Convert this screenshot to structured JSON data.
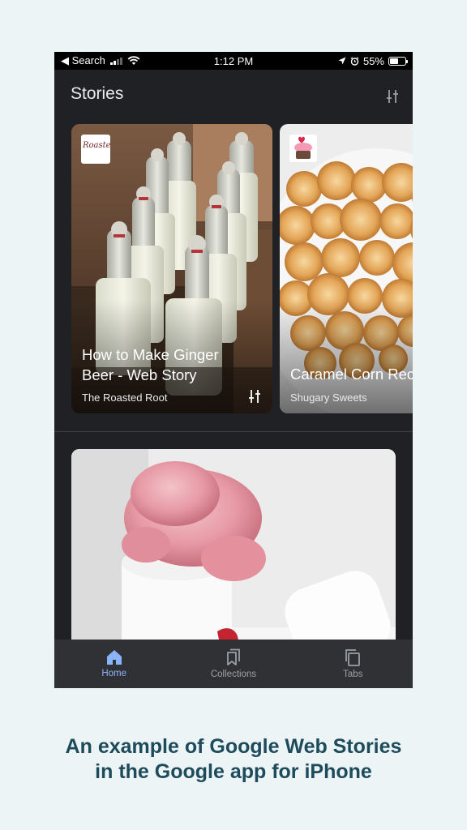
{
  "status_bar": {
    "back_label": "◀ Search",
    "time": "1:12 PM",
    "battery": "55%",
    "battery_level": 0.55
  },
  "header": {
    "title": "Stories"
  },
  "stories": [
    {
      "title": "How to Make Ginger Beer - Web Story",
      "source": "The Roasted Root"
    },
    {
      "title": "Caramel Corn Rec",
      "source": "Shugary Sweets"
    }
  ],
  "bottom_nav": {
    "items": [
      {
        "label": "Home",
        "icon": "home-icon",
        "active": true
      },
      {
        "label": "Collections",
        "icon": "collections-icon",
        "active": false
      },
      {
        "label": "Tabs",
        "icon": "tabs-icon",
        "active": false
      }
    ]
  },
  "colors": {
    "accent": "#8ab4f8",
    "background": "#202124",
    "caption": "#1e4b5c"
  },
  "caption": {
    "line1": "An example of Google Web Stories",
    "line2": "in the Google app for iPhone"
  }
}
